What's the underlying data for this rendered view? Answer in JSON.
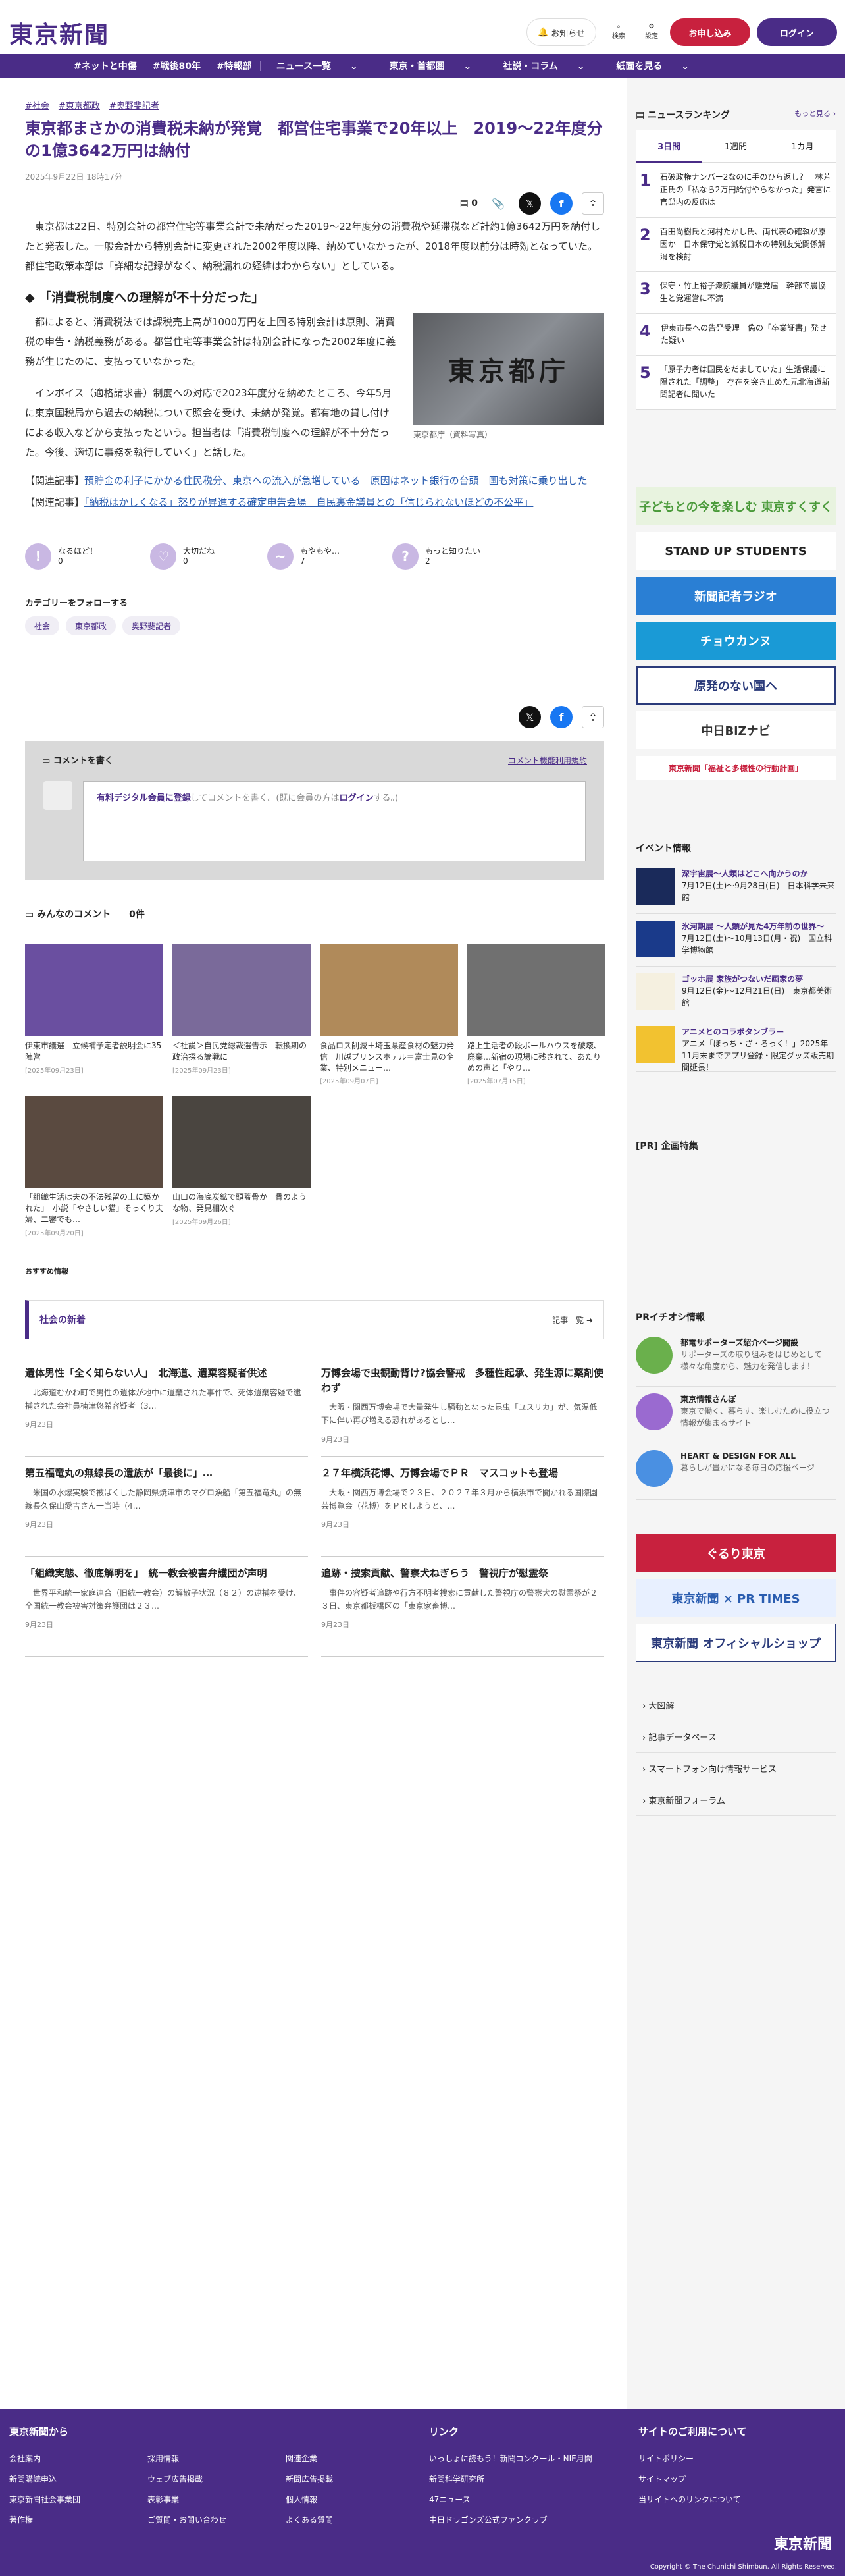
{
  "header": {
    "logo": "東京新聞",
    "notice": "お知らせ",
    "search": "検索",
    "settings": "設定",
    "subscribe": "お申し込み",
    "login": "ログイン"
  },
  "nav": [
    "#ネットと中傷",
    "#戦後80年",
    "#特報部",
    "ニュース一覧",
    "東京・首都圏",
    "社説・コラム",
    "紙面を見る"
  ],
  "article": {
    "tags": [
      "#社会",
      "#東京都政",
      "#奥野斐記者"
    ],
    "title": "東京都まさかの消費税未納が発覚　都営住宅事業で20年以上　2019〜22年度分の1億3642万円は納付",
    "date": "2025年9月22日 18時17分",
    "bookmark_count": "0",
    "p1": "　東京都は22日、特別会計の都営住宅等事業会計で未納だった2019〜22年度分の消費税や延滞税など計約1億3642万円を納付したと発表した。一般会計から特別会計に変更された2002年度以降、納めていなかったが、2018年度以前分は時効となっていた。都住宅政策本部は「詳細な記録がなく、納税漏れの経緯はわからない」としている。",
    "subhead": "「消費税制度への理解が不十分だった」",
    "p2": "　都によると、消費税法では課税売上高が1000万円を上回る特別会計は原則、消費税の申告・納税義務がある。都営住宅等事業会計は特別会計になった2002年度に義務が生じたのに、支払っていなかった。",
    "p3": "　インボイス（適格請求書）制度への対応で2023年度分を納めたところ、今年5月に東京国税局から過去の納税について照会を受け、未納が発覚。都有地の貸し付けによる収入などから支払ったという。担当者は「消費税制度への理解が不十分だった。今後、適切に事務を執行していく」と話した。",
    "photo_text": "東京都庁",
    "photo_caption": "東京都庁（資料写真）",
    "related": [
      {
        "prefix": "【関連記事】",
        "text": "預貯金の利子にかかる住民税分、東京への流入が急増している　原因はネット銀行の台頭　国も対策に乗り出した"
      },
      {
        "prefix": "【関連記事】",
        "text": "「納税はかしくなる」怒りが昇進する確定申告会場　自民裏金議員との「信じられないほどの不公平」"
      }
    ],
    "reactions": [
      {
        "label": "なるほど！",
        "count": "0",
        "icon": "!"
      },
      {
        "label": "大切だね",
        "count": "0",
        "icon": "♡"
      },
      {
        "label": "もやもや…",
        "count": "7",
        "icon": "~"
      },
      {
        "label": "もっと知りたい",
        "count": "2",
        "icon": "?"
      }
    ],
    "follow_label": "カテゴリーをフォローする",
    "follow_tags": [
      "社会",
      "東京都政",
      "奥野斐記者"
    ]
  },
  "comments": {
    "write_label": "コメントを書く",
    "rules": "コメント機能利用規約",
    "prompt_link": "有料デジタル会員に登録",
    "prompt_text": "してコメントを書く。(既に会員の方は",
    "prompt_login": "ログイン",
    "prompt_end": "する。)",
    "all_label": "みんなのコメント",
    "all_count": "0件"
  },
  "cards": [
    {
      "title": "伊東市議選　立候補予定者説明会に35陣営",
      "date": "[2025年09月23日]",
      "bg": "#6a4fa0"
    },
    {
      "title": "＜社説＞自民党総裁選告示　転換期の政治探る論戦に",
      "date": "[2025年09月23日]",
      "bg": "#7a6a9a"
    },
    {
      "title": "食品ロス削減＋埼玉県産食材の魅力発信　川越プリンスホテル＝富士見の企業、特別メニュー…",
      "date": "[2025年09月07日]",
      "bg": "#b08a5a"
    },
    {
      "title": "路上生活者の段ボールハウスを破壊、廃棄…新宿の現場に残されて、あたりめの声と「やり…",
      "date": "[2025年07月15日]",
      "bg": "#707070"
    },
    {
      "title": "「組織生活は夫の不法残留の上に築かれた」　小説「やさしい猫」そっくり夫婦、二審でも…",
      "date": "[2025年09月20日]",
      "bg": "#5a4a40"
    },
    {
      "title": "山口の海底炭鉱で頭蓋骨か　骨のような物、発見相次ぐ",
      "date": "[2025年09月26日]",
      "bg": "#4a4540"
    }
  ],
  "recommend": "おすすめ情報",
  "news": {
    "head": "社会の新着",
    "more": "記事一覧",
    "items": [
      {
        "title": "遺体男性「全く知らない人」　北海道、遺棄容疑者供述",
        "body": "　北海道むかわ町で男性の遺体が地中に遺棄された事件で、死体遺棄容疑で逮捕された会社員楠津悠希容疑者（3…",
        "date": "9月23日"
      },
      {
        "title": "万博会場で虫観動背け?協会警戒　多種性起承、発生源に薬剤使わず",
        "body": "　大阪・関西万博会場で大量発生し騒動となった昆虫「ユスリカ」が、気温低下に伴い再び増える恐れがあるとし…",
        "date": "9月23日"
      },
      {
        "title": "第五福竜丸の無線長の遺族が「最後に」…",
        "body": "　米国の水爆実験で被ばくした静岡県焼津市のマグロ漁船「第五福竜丸」の無線長久保山愛吉さん一当時（4…",
        "date": "9月23日"
      },
      {
        "title": "２７年横浜花博、万博会場でＰＲ　マスコットも登場",
        "body": "　大阪・関西万博会場で２３日、２０２７年３月から横浜市で開かれる国際園芸博覧会（花博）をＰＲしようと、…",
        "date": "9月23日"
      },
      {
        "title": "「組織実態、徹底解明を」　統一教会被害弁護団が声明",
        "body": "　世界平和統一家庭連合（旧統一教会）の解散子状況（８２）の逮捕を受け、全国統一教会被害対策弁護団は２３…",
        "date": "9月23日"
      },
      {
        "title": "追跡・捜索貢献、警察犬ねぎらう　警視庁が慰霊祭",
        "body": "　事件の容疑者追跡や行方不明者捜索に貢献した警視庁の警察犬の慰霊祭が２３日、東京都板橋区の「東京家畜博…",
        "date": "9月23日"
      }
    ]
  },
  "sidebar": {
    "ranking_head": "ニュースランキング",
    "ranking_more": "もっと見る",
    "tabs": [
      "3日間",
      "1週間",
      "1カ月"
    ],
    "ranking": [
      {
        "n": "1",
        "t": "石破政権ナンバー2なのに手のひら返し？　林芳正氏の「私なら2万円給付やらなかった」発言に官邸内の反応は"
      },
      {
        "n": "2",
        "t": "百田尚樹氏と河村たかし氏、両代表の確執が原因か　日本保守党と減税日本の特別友党関係解消を検討"
      },
      {
        "n": "3",
        "t": "保守・竹上裕子衆院議員が離党届　幹部で農協生と党運営に不満"
      },
      {
        "n": "4",
        "t": "伊東市長への告発受理　偽の「卒業証書」発せた疑い"
      },
      {
        "n": "5",
        "t": "「原子力者は国民をだましていた」生活保護に隠された「調整」　存在を突き止めた元北海道新聞記者に聞いた"
      }
    ],
    "banners": [
      {
        "text": "子どもとの今を楽しむ 東京すくすく",
        "bg": "#e8f3df",
        "fg": "#4a9a3a"
      },
      {
        "text": "STAND UP STUDENTS",
        "bg": "#ffffff",
        "fg": "#222"
      },
      {
        "text": "新聞記者ラジオ",
        "bg": "#2a7fd4",
        "fg": "#fff"
      },
      {
        "text": "チョウカンヌ",
        "bg": "#1a9ad6",
        "fg": "#fff"
      },
      {
        "text": "原発のない国へ",
        "bg": "#ffffff",
        "fg": "#2a3a7a"
      },
      {
        "text": "中日BiZナビ",
        "bg": "#ffffff",
        "fg": "#333"
      },
      {
        "text": "東京新聞「福祉と多様性の行動計画」",
        "bg": "#ffffff",
        "fg": "#c8213e"
      }
    ],
    "event_head": "イベント情報",
    "events": [
      {
        "title": "深宇宙展〜人類はどこへ向かうのか",
        "body": "7月12日(土)〜9月28日(日)　日本科学未来館",
        "bg": "#1a2a5a"
      },
      {
        "title": "氷河期展 〜人類が見た4万年前の世界〜",
        "body": "7月12日(土)〜10月13日(月・祝)　国立科学博物館",
        "bg": "#1a3a8a"
      },
      {
        "title": "ゴッホ展 家族がつないだ画家の夢",
        "body": "9月12日(金)〜12月21日(日)　東京都美術館",
        "bg": "#f5f0e0"
      },
      {
        "title": "アニメとのコラボタンブラー",
        "body": "アニメ「ぼっち・ざ・ろっく！」2025年11月末までアプリ登録・限定グッズ販売期間延長！",
        "bg": "#f2c230"
      }
    ],
    "pr_head": "[PR] 企画特集",
    "pr2_head": "PRイチオシ情報",
    "prs": [
      {
        "title": "都電サポーターズ紹介ページ開設",
        "body": "サポーターズの取り組みをはじめとして様々な角度から、魅力を発信します！",
        "bg": "#6ab04c"
      },
      {
        "title": "東京情報さんぽ",
        "body": "東京で働く、暮らす、楽しむために役立つ情報が集まるサイト",
        "bg": "#9a6ad0"
      },
      {
        "title": "HEART & DESIGN FOR ALL",
        "body": "暮らしが豊かになる毎日の応援ページ",
        "bg": "#4a90e2"
      }
    ],
    "banners2": [
      {
        "text": "ぐるり東京",
        "bg": "#c8213e",
        "fg": "#fff"
      },
      {
        "text": "東京新聞 × PR TIMES",
        "bg": "#e8f0ff",
        "fg": "#2a5db0"
      },
      {
        "text": "東京新聞 オフィシャルショップ",
        "bg": "#ffffff",
        "fg": "#2a3a7a"
      }
    ],
    "links": [
      "大図解",
      "記事データベース",
      "スマートフォン向け情報サービス",
      "東京新聞フォーラム"
    ]
  },
  "footer": {
    "col1_head": "東京新聞から",
    "col1": [
      "会社案内",
      "採用情報",
      "関連企業",
      "新聞購読申込",
      "ウェブ広告掲載",
      "新聞広告掲載",
      "東京新聞社会事業団",
      "表彰事業",
      "個人情報",
      "著作権",
      "ご質問・お問い合わせ",
      "よくある質問"
    ],
    "col2_head": "リンク",
    "col2": [
      "いっしょに読もう！新聞コンクール・NIE月間",
      "新聞科学研究所",
      "47ニュース",
      "中日ドラゴンズ公式ファンクラブ"
    ],
    "col3_head": "サイトのご利用について",
    "col3": [
      "サイトポリシー",
      "サイトマップ",
      "当サイトへのリンクについて"
    ],
    "logo": "東京新聞",
    "copyright": "Copyright © The Chunichi Shimbun, All Rights Reserved."
  }
}
